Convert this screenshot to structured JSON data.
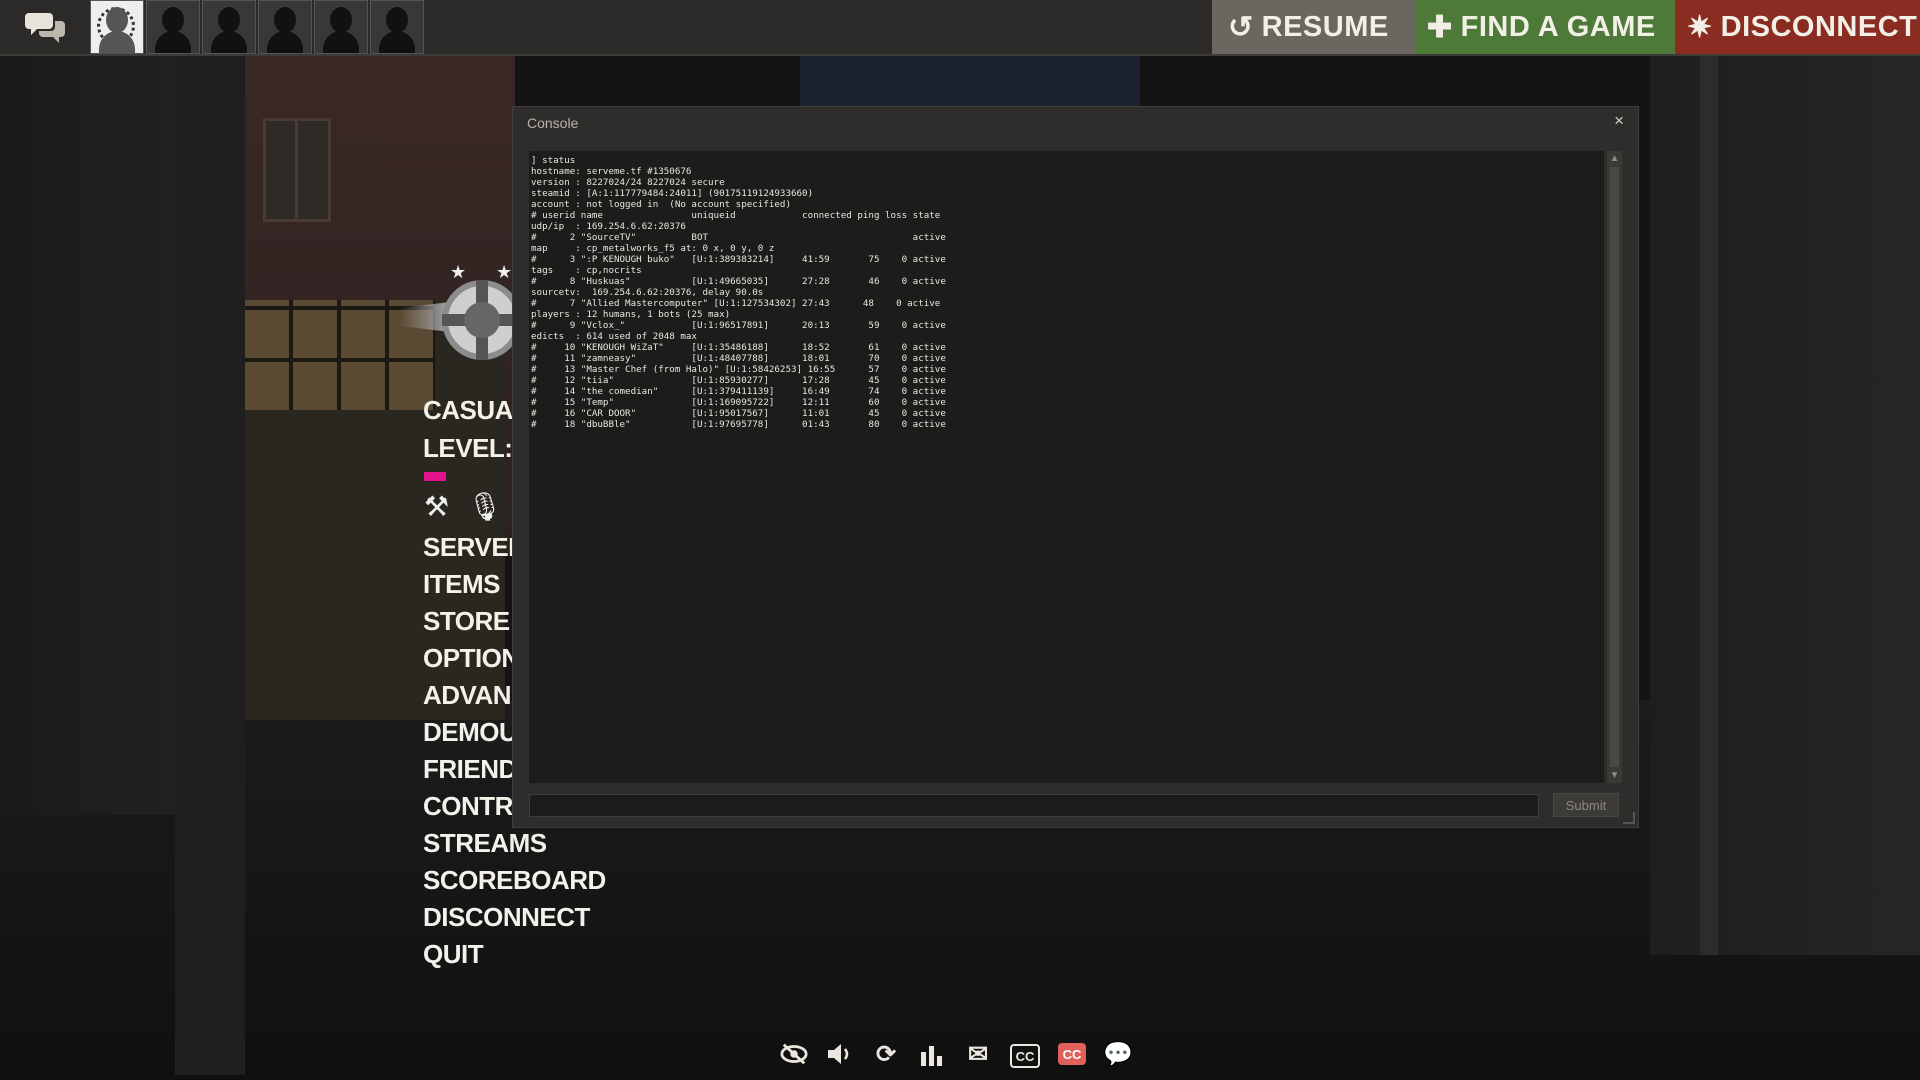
{
  "topbar": {
    "chat_icon": "chat-bubbles-icon",
    "party_slots": [
      "avatar",
      "empty",
      "empty",
      "empty",
      "empty",
      "empty"
    ],
    "resume_label": "RESUME",
    "find_game_label": "FIND A GAME",
    "disconnect_label": "DISCONNECT",
    "colors": {
      "resume": "#6b6660",
      "find_game": "#4d7a38",
      "disconnect": "#8a2c22"
    }
  },
  "menu": {
    "casual": "CASUA",
    "level": "LEVEL:",
    "xp_color": "#e4128a",
    "items": [
      "SERVEF",
      "ITEMS",
      "STORE",
      "OPTION",
      "ADVAN",
      "DEMOU",
      "FRIEND",
      "CONTR",
      "STREAMS",
      "SCOREBOARD",
      "DISCONNECT",
      "QUIT"
    ]
  },
  "console": {
    "title": "Console",
    "close": "×",
    "submit_label": "Submit",
    "input_value": "",
    "output": "] status\nhostname: serveme.tf #1350676\nversion : 8227024/24 8227024 secure\nsteamid : [A:1:117779484:24011] (90175119124933660)\naccount : not logged in  (No account specified)\n# userid name                uniqueid            connected ping loss state\nudp/ip  : 169.254.6.62:20376\n#      2 \"SourceTV\"          BOT                                     active\nmap     : cp_metalworks_f5 at: 0 x, 0 y, 0 z\n#      3 \":P KENOUGH buko\"   [U:1:389383214]     41:59       75    0 active\ntags    : cp,nocrits\n#      8 \"Huskuas\"           [U:1:49665035]      27:28       46    0 active\nsourcetv:  169.254.6.62:20376, delay 90.0s\n#      7 \"Allied Mastercomputer\" [U:1:127534302] 27:43      48    0 active\nplayers : 12 humans, 1 bots (25 max)\n#      9 \"Vclox_\"            [U:1:96517891]      20:13       59    0 active\nedicts  : 614 used of 2048 max\n#     10 \"KENOUGH WiZaT\"     [U:1:35486188]      18:52       61    0 active\n#     11 \"zamneasy\"          [U:1:48407788]      18:01       70    0 active\n#     13 \"Master Chef (from Halo)\" [U:1:58426253] 16:55      57    0 active\n#     12 \"tiia\"              [U:1:85930277]      17:28       45    0 active\n#     14 \"the comedian\"      [U:1:379411139]     16:49       74    0 active\n#     15 \"Temp\"              [U:1:169095722]     12:11       60    0 active\n#     16 \"CAR DOOR\"          [U:1:95017567]      11:01       45    0 active\n#     18 \"dbuBBle\"           [U:1:97695778]      01:43       80    0 active"
  },
  "bottombar": {
    "icons": [
      "hide-eye-icon",
      "speaker-icon",
      "refresh-icon",
      "stats-icon",
      "mail-icon",
      "cc-icon",
      "cc-red-icon",
      "chat-icon"
    ],
    "cc_label": "CC"
  }
}
